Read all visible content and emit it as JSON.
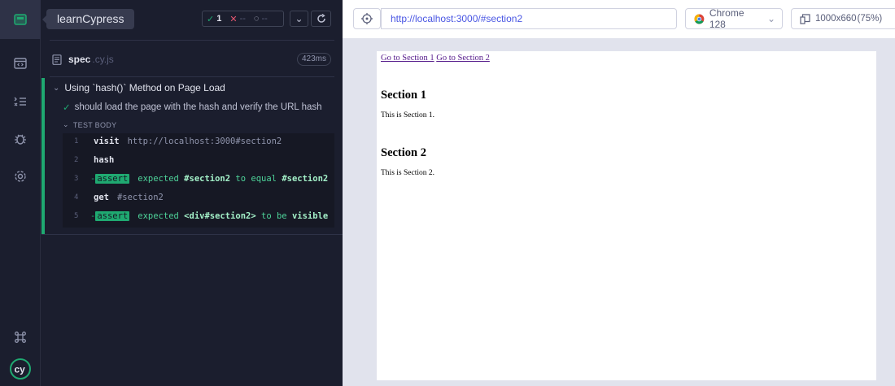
{
  "nav": {
    "tooltip": "learnCypress",
    "items": [
      "specs-icon",
      "runs-icon",
      "test-list-icon",
      "debug-icon",
      "settings-icon"
    ]
  },
  "reporter": {
    "stats": {
      "passed": "1",
      "failed": "--",
      "pending": "--"
    },
    "spec": {
      "name": "spec",
      "ext": ".cy.js",
      "duration": "423ms"
    },
    "suite_title": "Using `hash()` Method on Page Load",
    "test_title": "should load the page with the hash and verify the URL hash",
    "body_label": "TEST BODY",
    "commands": [
      {
        "num": "1",
        "name": "visit",
        "message": "http://localhost:3000#section2"
      },
      {
        "num": "2",
        "name": "hash",
        "message": ""
      },
      {
        "num": "3",
        "badge": "assert",
        "parts": [
          "expected",
          "#section2",
          "to equal",
          "#section2"
        ]
      },
      {
        "num": "4",
        "name": "get",
        "message": "#section2"
      },
      {
        "num": "5",
        "badge": "assert",
        "parts": [
          "expected",
          "<div#section2>",
          "to be",
          "visible"
        ]
      }
    ]
  },
  "browser": {
    "url": "http://localhost:3000/#section2",
    "browser_name": "Chrome 128",
    "viewport": "1000x660",
    "zoom": "(75%)"
  },
  "aut": {
    "link1": "Go to Section 1",
    "link2": "Go to Section 2",
    "section1_heading": "Section 1",
    "section1_text": "This is Section 1.",
    "section2_heading": "Section 2",
    "section2_text": "This is Section 2."
  },
  "colors": {
    "accent": "#1fa971",
    "sidebar": "#1b1e2e",
    "url": "#4956e3"
  }
}
